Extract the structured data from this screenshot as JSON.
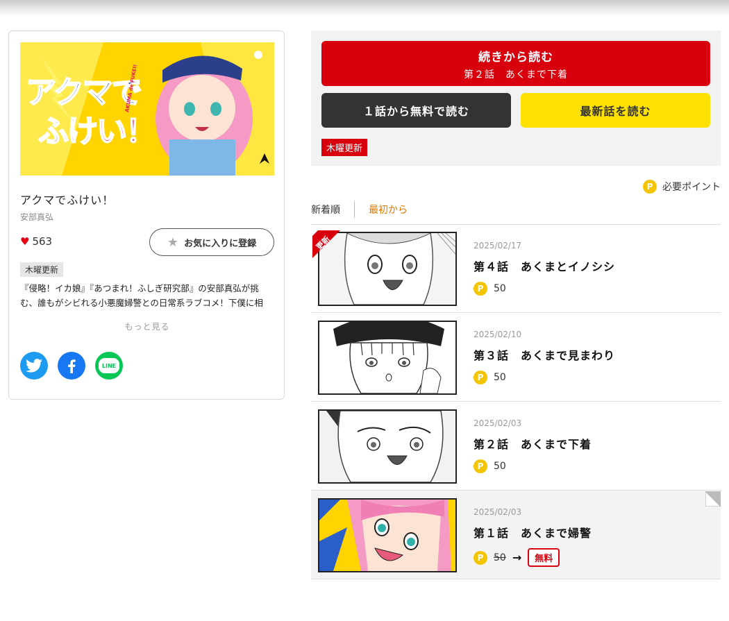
{
  "series": {
    "title": "アクマでふけい！",
    "author": "安部真弘",
    "likes": "563",
    "favorite_label": "お気に入りに登録",
    "day_tag": "木曜更新",
    "description": "『侵略！イカ娘』『あつまれ！ふしぎ研究部』の安部真弘が挑む、誰もがシビれる小悪魔婦警との日常系ラブコメ！下僕に相",
    "more_label": "もっと見る",
    "cover_title_top": "アクマで",
    "cover_title_bottom": "ふけい！",
    "cover_romaji": "AKUMA de FUKEI!"
  },
  "social": {
    "twitter": "twitter-icon",
    "facebook": "facebook-icon",
    "line_text": "LINE"
  },
  "actions": {
    "continue_label": "続きから読む",
    "continue_sub": "第２話　あくまで下着",
    "free_label": "１話から無料で読む",
    "latest_label": "最新話を読む",
    "day_tag": "木曜更新"
  },
  "point_req": {
    "coin": "P",
    "label": "必要ポイント"
  },
  "sort": {
    "newest": "新着順",
    "oldest": "最初から"
  },
  "episodes": [
    {
      "date": "2025/02/17",
      "title": "第４話　あくまとイノシシ",
      "coin": "P",
      "price": "50",
      "badge": "更新"
    },
    {
      "date": "2025/02/10",
      "title": "第３話　あくまで見まわり",
      "coin": "P",
      "price": "50"
    },
    {
      "date": "2025/02/03",
      "title": "第２話　あくまで下着",
      "coin": "P",
      "price": "50"
    },
    {
      "date": "2025/02/03",
      "title": "第１話　あくまで婦警",
      "coin": "P",
      "price": "50",
      "free_label": "無料"
    }
  ],
  "colors": {
    "red": "#d9000d",
    "yellow": "#ffe100",
    "dark": "#333333",
    "coin": "#f5c400",
    "sort_active": "#e07800"
  }
}
